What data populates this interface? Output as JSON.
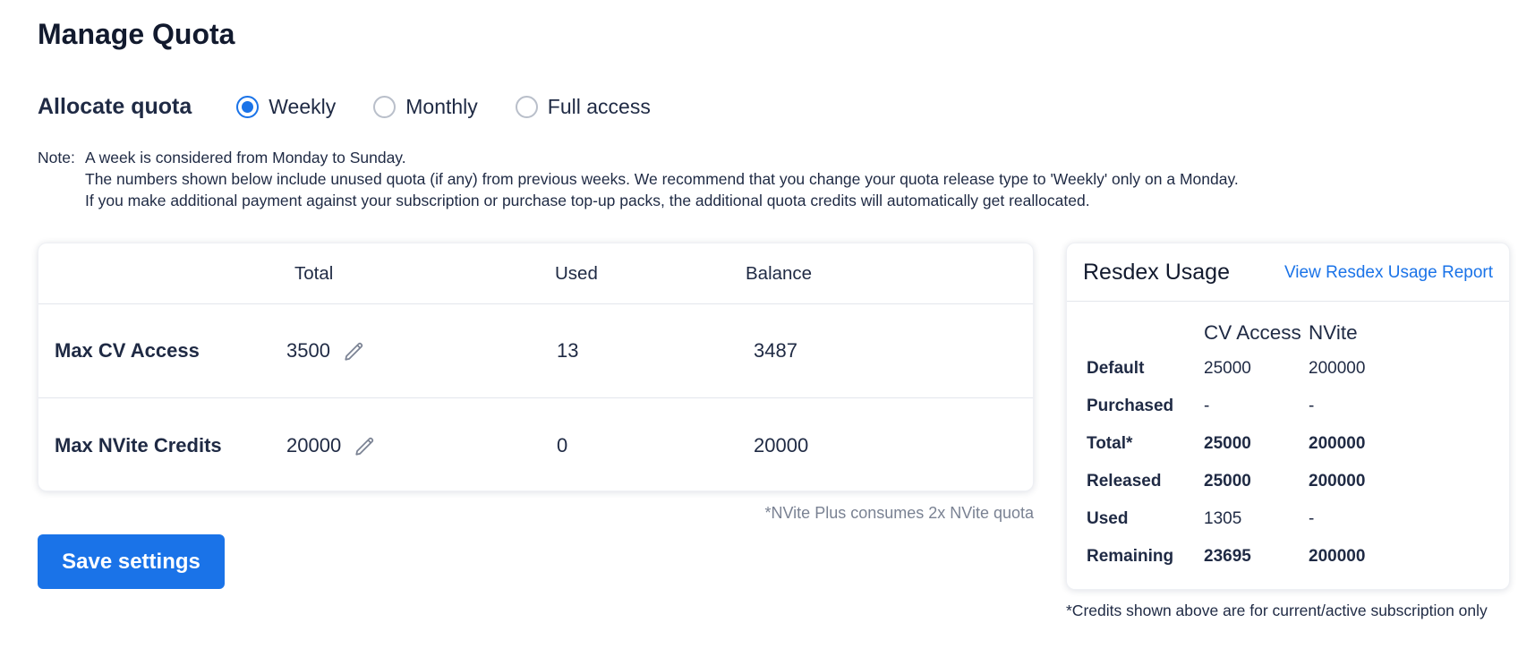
{
  "page": {
    "title": "Manage Quota"
  },
  "allocate": {
    "label": "Allocate quota",
    "options": [
      {
        "label": "Weekly",
        "selected": true
      },
      {
        "label": "Monthly",
        "selected": false
      },
      {
        "label": "Full access",
        "selected": false
      }
    ]
  },
  "note": {
    "prefix": "Note:",
    "lines": [
      "A week is considered from Monday to Sunday.",
      "The numbers shown below include unused quota (if any) from previous weeks. We recommend that you change your quota release type to 'Weekly' only on a Monday.",
      "If you make additional payment against your subscription or purchase top-up packs, the additional quota credits will automatically get reallocated."
    ]
  },
  "quota_table": {
    "headers": {
      "total": "Total",
      "used": "Used",
      "balance": "Balance"
    },
    "rows": [
      {
        "name": "Max CV Access",
        "total": "3500",
        "used": "13",
        "balance": "3487"
      },
      {
        "name": "Max NVite Credits",
        "total": "20000",
        "used": "0",
        "balance": "20000"
      }
    ],
    "footnote": "*NVite Plus consumes 2x NVite quota"
  },
  "save_button": {
    "label": "Save settings"
  },
  "resdex": {
    "title": "Resdex Usage",
    "link": "View Resdex Usage Report",
    "columns": {
      "cv": "CV Access",
      "nvite": "NVite"
    },
    "rows": [
      {
        "label": "Default",
        "cv": "25000",
        "nvite": "200000"
      },
      {
        "label": "Purchased",
        "cv": "-",
        "nvite": "-"
      },
      {
        "label": "Total*",
        "cv": "25000",
        "nvite": "200000"
      },
      {
        "label": "Released",
        "cv": "25000",
        "nvite": "200000"
      },
      {
        "label": "Used",
        "cv": "1305",
        "nvite": "-"
      },
      {
        "label": "Remaining",
        "cv": "23695",
        "nvite": "200000"
      }
    ],
    "footnote": "*Credits shown above are for current/active subscription only"
  },
  "colors": {
    "accent": "#1a73e8",
    "text": "#1f2a44",
    "muted": "#7a8293",
    "border": "#e3e6ec"
  },
  "icons": {
    "edit": "pencil-icon"
  }
}
